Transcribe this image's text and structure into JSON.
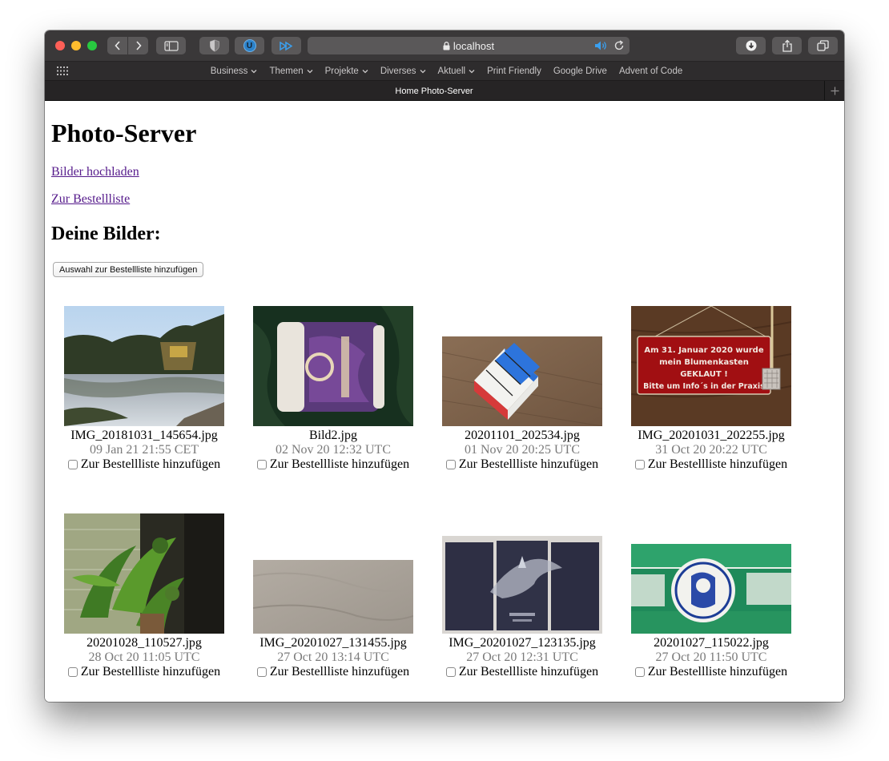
{
  "browser": {
    "address": "localhost",
    "tab_title": "Home Photo-Server",
    "favorites": [
      {
        "label": "Business",
        "has_menu": true
      },
      {
        "label": "Themen",
        "has_menu": true
      },
      {
        "label": "Projekte",
        "has_menu": true
      },
      {
        "label": "Diverses",
        "has_menu": true
      },
      {
        "label": "Aktuell",
        "has_menu": true
      },
      {
        "label": "Print Friendly",
        "has_menu": false
      },
      {
        "label": "Google Drive",
        "has_menu": false
      },
      {
        "label": "Advent of Code",
        "has_menu": false
      }
    ],
    "extension_badge": "U"
  },
  "page": {
    "title": "Photo-Server",
    "upload_link": "Bilder hochladen",
    "order_list_link": "Zur Bestellliste",
    "section_title": "Deine Bilder:",
    "add_selection_button": "Auswahl zur Bestellliste hinzufügen",
    "checkbox_label": "Zur Bestellliste hinzufügen"
  },
  "photos": [
    {
      "filename": "IMG_20181031_145654.jpg",
      "date": "09 Jan 21 21:55 CET",
      "checked": false
    },
    {
      "filename": "Bild2.jpg",
      "date": "02 Nov 20 12:32 UTC",
      "checked": false
    },
    {
      "filename": "20201101_202534.jpg",
      "date": "01 Nov 20 20:25 UTC",
      "checked": false
    },
    {
      "filename": "IMG_20201031_202255.jpg",
      "date": "31 Oct 20 20:22 UTC",
      "checked": false,
      "sign_text": [
        "Am 31. Januar 2020 wurde",
        "mein Blumenkasten",
        "GEKLAUT !",
        "Bitte um Info´s in der Praxis"
      ]
    },
    {
      "filename": "20201028_110527.jpg",
      "date": "28 Oct 20 11:05 UTC",
      "checked": false
    },
    {
      "filename": "IMG_20201027_131455.jpg",
      "date": "27 Oct 20 13:14 UTC",
      "checked": false
    },
    {
      "filename": "IMG_20201027_123135.jpg",
      "date": "27 Oct 20 12:31 UTC",
      "checked": false
    },
    {
      "filename": "20201027_115022.jpg",
      "date": "27 Oct 20 11:50 UTC",
      "checked": false
    }
  ]
}
